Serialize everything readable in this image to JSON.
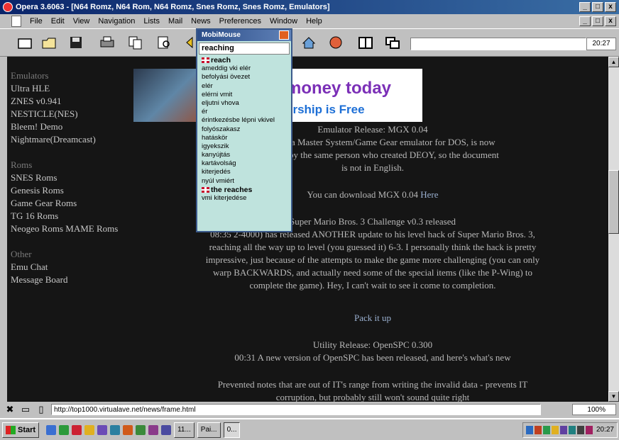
{
  "window": {
    "title": "Opera 3.6063 - [N64 Romz, N64 Rom, N64 Romz, Snes Romz, Snes Romz, Emulators]",
    "controls": [
      "_",
      "□",
      "x"
    ]
  },
  "menu": [
    "File",
    "Edit",
    "View",
    "Navigation",
    "Lists",
    "Mail",
    "News",
    "Preferences",
    "Window",
    "Help"
  ],
  "toolbar": {
    "icons": [
      "new-page-icon",
      "open-icon",
      "save-icon",
      "print-icon",
      "copy-icon",
      "find-icon",
      "back-icon",
      "home-icon",
      "hotlist-icon",
      "tile-icon",
      "cascade-icon"
    ],
    "time": "20:27"
  },
  "sidebar": {
    "sections": [
      {
        "heading": "Emulators",
        "links": [
          "Ultra HLE",
          "ZNES v0.941",
          "NESTICLE(NES)",
          "Bleem! Demo",
          "Nightmare(Dreamcast)"
        ]
      },
      {
        "heading": "Roms",
        "links": [
          "SNES Roms",
          "Genesis Roms",
          "Game Gear Roms",
          "TG 16 Roms",
          "Neogeo Roms MAME Roms"
        ]
      },
      {
        "heading": "Other",
        "links": [
          "Emu Chat",
          "Message Board"
        ]
      }
    ]
  },
  "banner": {
    "line1": "money today",
    "line2": "ership is Free"
  },
  "content": {
    "news1_title": "Emulator Release: MGX 0.04",
    "news1_l1": "11:80          GX, a Master System/Game Gear emulator for DOS, is now",
    "news1_l2": "availabl          de by the same person who created DEOY, so the document",
    "news1_l3": "is not in English.",
    "download_text": "You can download MGX 0.04",
    "download_link": "Here",
    "news2_title": "Super Mario Bros. 3 Challenge v0.3 released",
    "news2_l1": "08:35    2-4000) has released ANOTHER update to his level hack of Super Mario Bros. 3,",
    "news2_l2": "reaching all the way up to level (you guessed it) 6-3. I personally think the hack is pretty",
    "news2_l3": "impressive, just because of the attempts to make the game more challenging (you can only",
    "news2_l4": "warp BACKWARDS, and actually need some of the special items (like the P-Wing) to",
    "news2_l5": "complete the game). Hey, I can't wait to see it come to completion.",
    "pack_link": "Pack it up",
    "news3_title": "Utility Release: OpenSPC 0.300",
    "news3_l1": "00:31  A new version of OpenSPC has been released, and here's what's new",
    "news3_l2": "Prevented notes that are out of IT's range from writing the invalid data - prevents IT",
    "news3_l3": "corruption, but probably still won't sound quite right"
  },
  "popup": {
    "title": "MobiMouse",
    "query": "reaching",
    "items": [
      {
        "text": "reach",
        "head": true
      },
      {
        "text": "ameddig vki elér",
        "head": false
      },
      {
        "text": "befolyási övezet",
        "head": false
      },
      {
        "text": "elér",
        "head": false
      },
      {
        "text": "elérni vmit",
        "head": false
      },
      {
        "text": "eljutni vhova",
        "head": false
      },
      {
        "text": "ér",
        "head": false
      },
      {
        "text": "érintkezésbe lépni vkivel",
        "head": false
      },
      {
        "text": "folyószakasz",
        "head": false
      },
      {
        "text": "hatáskör",
        "head": false
      },
      {
        "text": "igyekszik",
        "head": false
      },
      {
        "text": "kanyújtás",
        "head": false
      },
      {
        "text": "kartávolság",
        "head": false
      },
      {
        "text": "kiterjedés",
        "head": false
      },
      {
        "text": "nyúl vmiért",
        "head": false
      },
      {
        "text": "the reaches",
        "head": true
      },
      {
        "text": "vmi kiterjedése",
        "head": false
      }
    ]
  },
  "addressbar": {
    "url": "http://top1000.virtualave.net/news/frame.html",
    "zoom": "100%"
  },
  "taskbar": {
    "start": "Start",
    "tasks": [
      {
        "label": "11...",
        "active": false
      },
      {
        "label": "Pai...",
        "active": false
      },
      {
        "label": "0...",
        "active": true
      }
    ],
    "time": "20:27"
  },
  "colors": {
    "titlebar": "#0a246a",
    "page_bg": "#151515",
    "popup_bg": "#bfe3dd",
    "banner_purple": "#7b2fb7",
    "banner_blue": "#1d6fd6"
  }
}
